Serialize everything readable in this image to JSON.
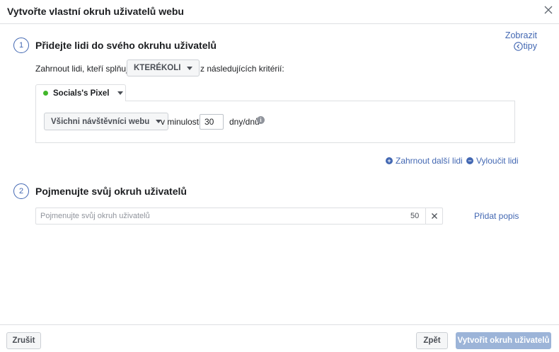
{
  "dialog": {
    "title": "Vytvořte vlastní okruh uživatelů webu",
    "tips_line1": "Zobrazit",
    "tips_line2": "tipy"
  },
  "step1": {
    "number": "1",
    "title": "Přidejte lidi do svého okruhu uživatelů",
    "include_prefix": "Zahrnout lidi, kteří splňují",
    "match_dropdown": "KTERÉKOLI",
    "include_suffix": "z následujících kritérií:",
    "pixel_name": "Socials's Pixel",
    "pixel_status_color": "#42b72a",
    "visitors_dropdown": "Všichni návštěvníci webu",
    "in_last_label": "v minulosti",
    "days_value": "30",
    "days_unit": "dny/dnů",
    "include_more": "Zahrnout další lidi",
    "exclude": "Vyloučit lidi"
  },
  "step2": {
    "number": "2",
    "title": "Pojmenujte svůj okruh uživatelů",
    "name_placeholder": "Pojmenujte svůj okruh uživatelů",
    "char_remaining": "50",
    "add_description": "Přidat popis"
  },
  "footer": {
    "cancel": "Zrušit",
    "back": "Zpět",
    "create": "Vytvořit okruh uživatelů"
  },
  "colors": {
    "accent": "#4267b2",
    "disabled_primary": "#9cb4d8"
  }
}
